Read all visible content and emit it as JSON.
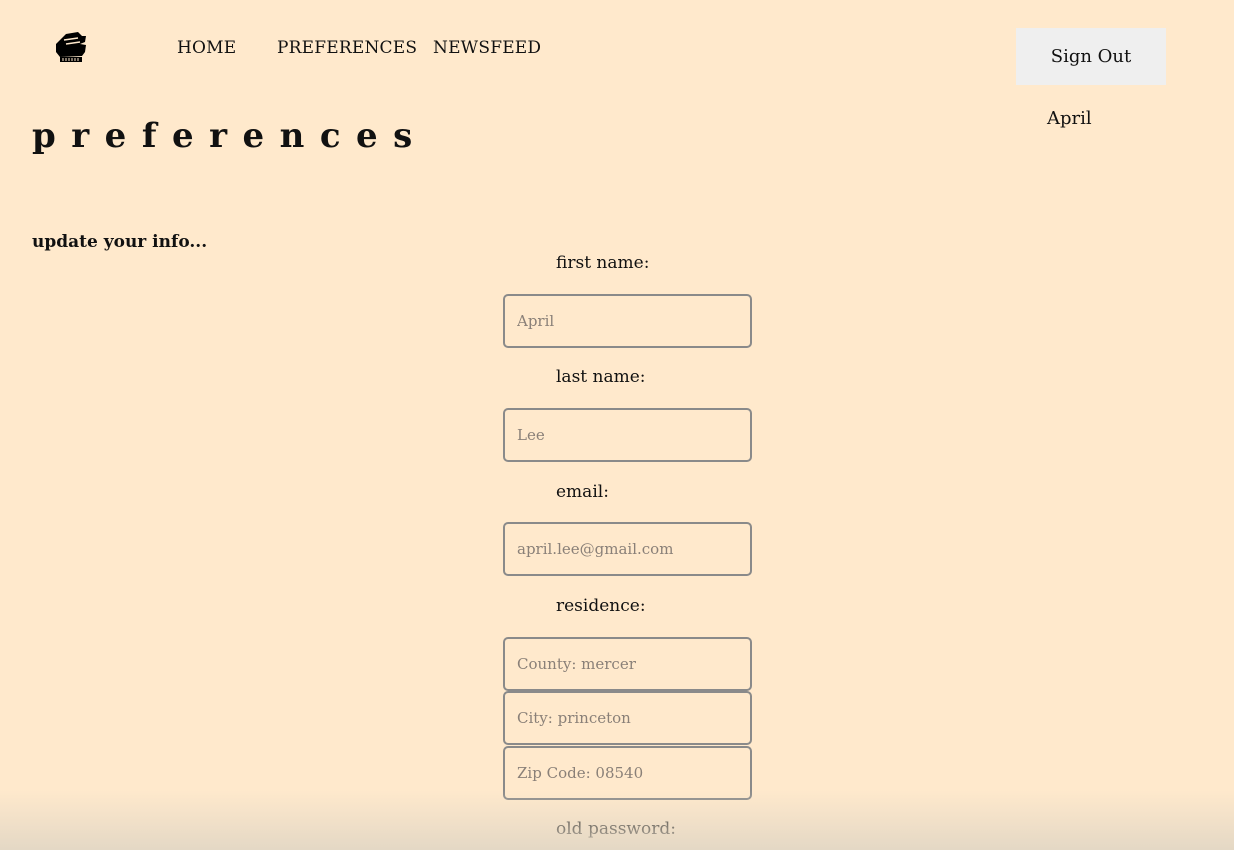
{
  "header": {
    "logo_icon": "fist-icon",
    "nav": [
      {
        "label": "HOME"
      },
      {
        "label": "PREFERENCES"
      },
      {
        "label": "NEWSFEED"
      }
    ],
    "signout_label": "Sign Out",
    "username": "April"
  },
  "main": {
    "title": "preferences",
    "subtitle": "update your info...",
    "fields": {
      "first_name": {
        "label": "first name:",
        "placeholder": "April"
      },
      "last_name": {
        "label": "last name:",
        "placeholder": "Lee"
      },
      "email": {
        "label": "email:",
        "placeholder": "april.lee@gmail.com"
      },
      "residence": {
        "label": "residence:",
        "county_placeholder": "County: mercer",
        "city_placeholder": "City: princeton",
        "zip_placeholder": "Zip Code: 08540"
      },
      "old_password": {
        "label": "old password:"
      }
    }
  },
  "colors": {
    "background": "#ffe9cc",
    "signout_bg": "#efefef",
    "field_border": "#8a8a8a"
  }
}
